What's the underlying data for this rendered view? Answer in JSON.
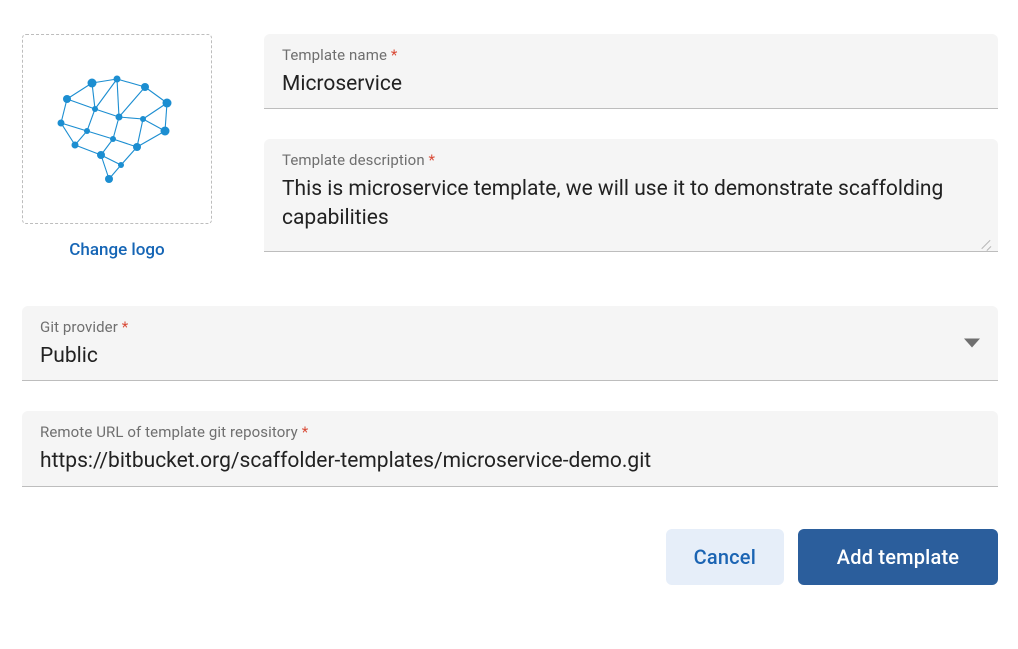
{
  "logo": {
    "change_label": "Change logo"
  },
  "name_field": {
    "label": "Template name",
    "required": "*",
    "value": "Microservice"
  },
  "desc_field": {
    "label": "Template description",
    "required": "*",
    "value": "This is microservice template, we will use it to demonstrate scaffolding capabilities"
  },
  "git_field": {
    "label": "Git provider",
    "required": "*",
    "value": "Public"
  },
  "url_field": {
    "label": "Remote URL of template git repository",
    "required": "*",
    "value": "https://bitbucket.org/scaffolder-templates/microservice-demo.git"
  },
  "buttons": {
    "cancel": "Cancel",
    "submit": "Add template"
  }
}
